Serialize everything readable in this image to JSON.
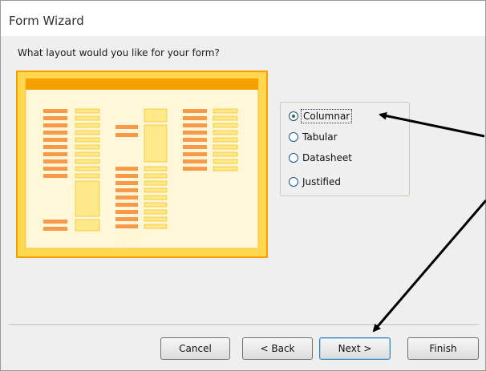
{
  "window": {
    "title": "Form Wizard"
  },
  "prompt": "What layout would you like for your form?",
  "layout_options": [
    {
      "label": "Columnar",
      "selected": true
    },
    {
      "label": "Tabular",
      "selected": false
    },
    {
      "label": "Datasheet",
      "selected": false
    },
    {
      "label": "Justified",
      "selected": false
    }
  ],
  "buttons": {
    "cancel": "Cancel",
    "back": "< Back",
    "next": "Next >",
    "finish": "Finish"
  },
  "colors": {
    "preview_fill": "#ffd84d",
    "preview_accent": "#f5a000",
    "field_label": "#f79a4a",
    "field_box": "#ffe98a",
    "annotation_arrow": "#000000"
  },
  "icons": {
    "radio": "radio-button-icon",
    "annotation": "arrow-icon"
  }
}
